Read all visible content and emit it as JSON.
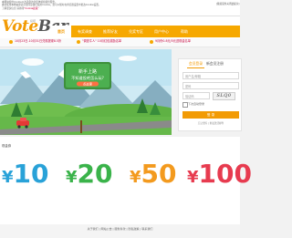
{
  "cookie_banner": {
    "text": "本网站使用Cookie以改善您的浏览体验和提供服务。\n继续使用本网站即表示您同意我们使用Cookie。您可以随时在浏览器设置中更改Cookie设置。\n了解更多信息 请参阅",
    "link": "\"Cookie政策\"",
    "close": "[我接受并关闭此提示]"
  },
  "header": {
    "logo_main": "Vote",
    "logo_accent": "Bar",
    "logo_sub": "投吧"
  },
  "nav": {
    "items": [
      {
        "label": "首页"
      },
      {
        "label": "有奖调查"
      },
      {
        "label": "推荐好友"
      },
      {
        "label": "兑奖专区"
      },
      {
        "label": "用户中心"
      },
      {
        "label": "帮助"
      }
    ]
  },
  "ticker": {
    "items": [
      {
        "text": "10月23日-10月31日兑现提现8.5折"
      },
      {
        "text": "\"调查牛人\" 10月红包奖励名单"
      },
      {
        "text": "9月份0.8元/5元送现金名单"
      }
    ]
  },
  "banner": {
    "line1": "新手上路",
    "line2": "不知道投吧怎么玩?",
    "button": "点这里"
  },
  "login": {
    "tab_login": "会员登录",
    "tab_register": "新会员注册",
    "username_placeholder": "用户名/邮箱",
    "password_placeholder": "密码",
    "captcha_placeholder": "验证码",
    "captcha_text": "SLQ0",
    "remember": "下次自动登录",
    "submit": "登 录",
    "links": "忘记密码 | 重发激活邮件"
  },
  "vouchers": {
    "section_title": "现金券",
    "currency": "¥",
    "items": [
      {
        "value": "10",
        "color": "#29a2d8"
      },
      {
        "value": "20",
        "color": "#3ab34a"
      },
      {
        "value": "50",
        "color": "#f39a1e"
      },
      {
        "value": "100",
        "color": "#e73b4f"
      }
    ]
  },
  "footer": {
    "links": "关于我们 | 网站公告 | 服务条款 | 隐私政策 | 联系我们"
  }
}
